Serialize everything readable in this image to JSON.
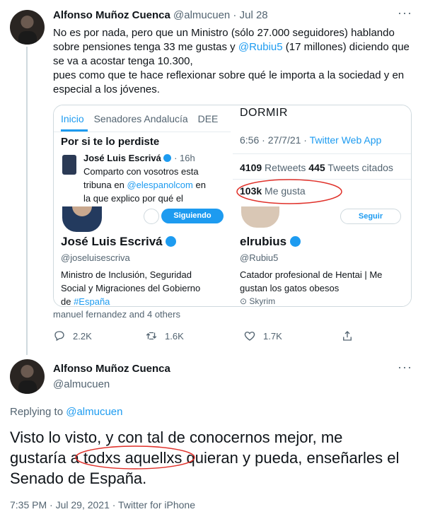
{
  "tweet1": {
    "author_name": "Alfonso Muñoz Cuenca",
    "handle_time": "@almucuen · Jul 28",
    "text_l1": "No es por nada, pero que un Ministro (sólo 27.000 seguidores) hablando",
    "text_l2a": "sobre pensiones tenga 33 me gustas y ",
    "mention": "@Rubiu5",
    "text_l2b": " (17 millones) diciendo que",
    "text_l3": "se va a acostar tenga 10.300,",
    "text_l4": "pues como que te hace reflexionar sobre qué le importa a la sociedad y en",
    "text_l5": "especial a los jóvenes.",
    "left_panel": {
      "tabs": [
        "Inicio",
        "Senadores Andalucía",
        "DEE"
      ],
      "heading": "Por si te lo perdiste",
      "inner_name": "José Luis Escrivá",
      "inner_time": "· 16h",
      "inner_l1": "Comparto con vosotros esta",
      "inner_l2a": "tribuna en ",
      "inner_l2b": "@elespanolcom",
      "inner_l2c": " en",
      "inner_l3": "la que explico por qué el",
      "follow_label": "Siguiendo",
      "profile_name": "José Luis Escrivá",
      "profile_handle": "@joseluisescriva",
      "bio_l1": "Ministro de Inclusión, Seguridad",
      "bio_l2": "Social y Migraciones del Gobierno",
      "bio_l3a": "de ",
      "bio_l3b": "#España"
    },
    "right_panel": {
      "title": "DORMIR",
      "meta_a": "6:56 · 27/7/21 · ",
      "meta_b": "Twitter Web App",
      "rt_count": "4109",
      "rt_label": " Retweets ",
      "qt_count": "445",
      "qt_label": " Tweets citados",
      "likes_count": "103k",
      "likes_label": " Me gusta",
      "follow_label": "Seguir",
      "profile_name": "elrubius",
      "profile_handle": "@Rubiu5",
      "bio_l1": "Catador profesional de Hentai | Me",
      "bio_l2": "gustan los gatos obesos",
      "location": "Skyrim"
    },
    "tagged": "manuel fernandez and 4 others",
    "replies": "2.2K",
    "retweets": "1.6K",
    "likes": "1.7K"
  },
  "tweet2": {
    "author_name": "Alfonso Muñoz Cuenca",
    "handle": "@almucuen",
    "replying_label": "Replying to ",
    "replying_handle": "@almucuen",
    "l1": "Visto lo visto, y con tal de conocernos mejor, me",
    "l2a": "gustaría a ",
    "l2b": "todxs aquellxs",
    "l2c": " quieran y pueda, enseñarles el",
    "l3": "Senado de España.",
    "meta": "7:35 PM · Jul 29, 2021 · Twitter for iPhone"
  },
  "colors": {
    "accent": "#1d9bf0",
    "annotation": "#e0312a"
  }
}
